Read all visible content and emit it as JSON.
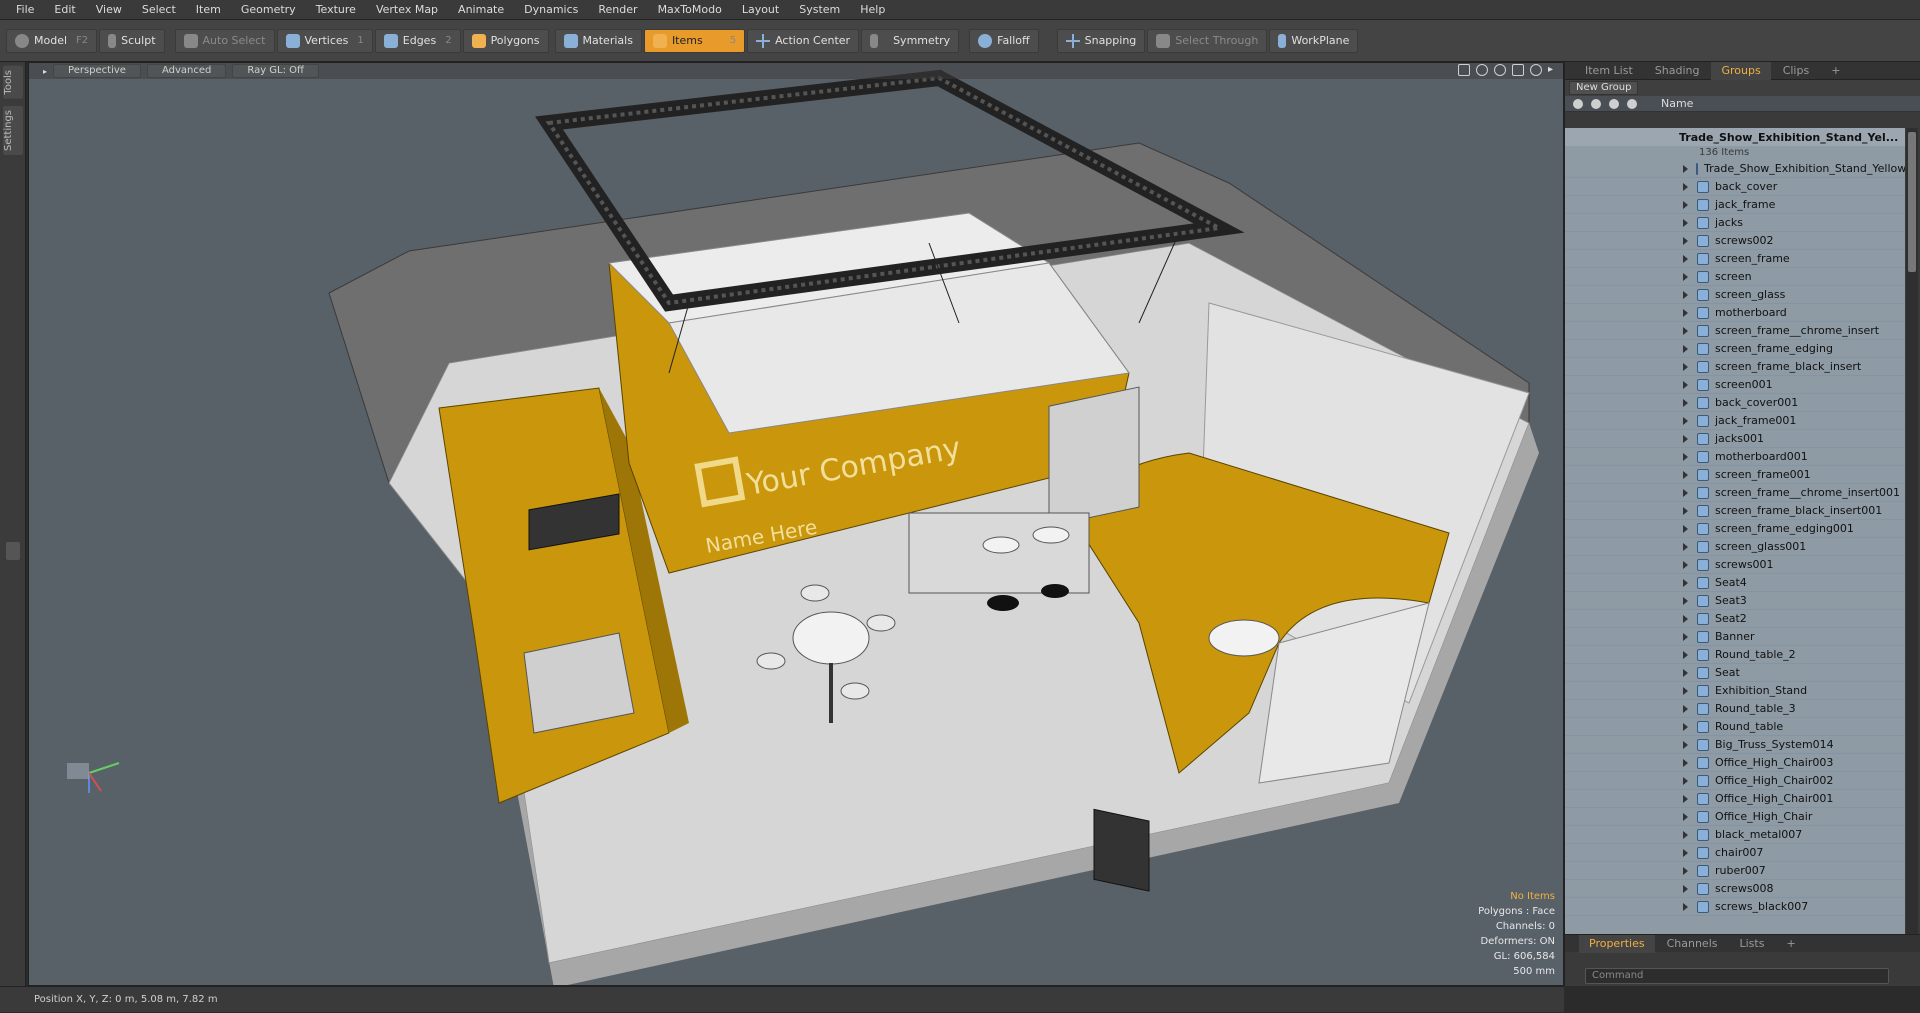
{
  "menu": [
    "File",
    "Edit",
    "View",
    "Select",
    "Item",
    "Geometry",
    "Texture",
    "Vertex Map",
    "Animate",
    "Dynamics",
    "Render",
    "MaxToModo",
    "Layout",
    "System",
    "Help"
  ],
  "toolbar": {
    "model": "Model",
    "model_key": "F2",
    "sculpt": "Sculpt",
    "auto_select": "Auto Select",
    "vertices": "Vertices",
    "vertices_key": "1",
    "edges": "Edges",
    "edges_key": "2",
    "polygons": "Polygons",
    "materials": "Materials",
    "items": "Items",
    "items_key": "5",
    "action_center": "Action Center",
    "symmetry": "Symmetry",
    "falloff": "Falloff",
    "snapping": "Snapping",
    "select_through": "Select Through",
    "workplane": "WorkPlane"
  },
  "left_tabs": [
    "Tools",
    "Settings"
  ],
  "viewport": {
    "view": "Perspective",
    "shading": "Advanced",
    "raygl": "Ray GL: Off",
    "hud": [
      "No Items",
      "Polygons : Face",
      "Channels: 0",
      "Deformers: ON",
      "GL: 606,584",
      "500 mm"
    ],
    "booth_text_1": "Your Company",
    "booth_text_2": "Name Here"
  },
  "status": "Position X, Y, Z:   0 m, 5.08 m, 7.82 m",
  "panel": {
    "tabs": [
      "Item List",
      "Shading",
      "Groups",
      "Clips",
      "+"
    ],
    "active_tab": "Groups",
    "new_group": "New Group",
    "col_name": "Name",
    "root": "Trade_Show_Exhibition_Stand_Yel...",
    "count": "136 Items",
    "items": [
      "Trade_Show_Exhibition_Stand_Yellow",
      "back_cover",
      "jack_frame",
      "jacks",
      "screws002",
      "screen_frame",
      "screen",
      "screen_glass",
      "motherboard",
      "screen_frame__chrome_insert",
      "screen_frame_edging",
      "screen_frame_black_insert",
      "screen001",
      "back_cover001",
      "jack_frame001",
      "jacks001",
      "motherboard001",
      "screen_frame001",
      "screen_frame__chrome_insert001",
      "screen_frame_black_insert001",
      "screen_frame_edging001",
      "screen_glass001",
      "screws001",
      "Seat4",
      "Seat3",
      "Seat2",
      "Banner",
      "Round_table_2",
      "Seat",
      "Exhibition_Stand",
      "Round_table_3",
      "Round_table",
      "Big_Truss_System014",
      "Office_High_Chair003",
      "Office_High_Chair002",
      "Office_High_Chair001",
      "Office_High_Chair",
      "black_metal007",
      "chair007",
      "ruber007",
      "screws008",
      "screws_black007"
    ],
    "bottom_tabs": [
      "Properties",
      "Channels",
      "Lists",
      "+"
    ],
    "command_placeholder": "Command"
  },
  "colors": {
    "accent": "#e89a2a",
    "booth_yellow": "#c9960c",
    "viewport_bg": "#586068"
  }
}
